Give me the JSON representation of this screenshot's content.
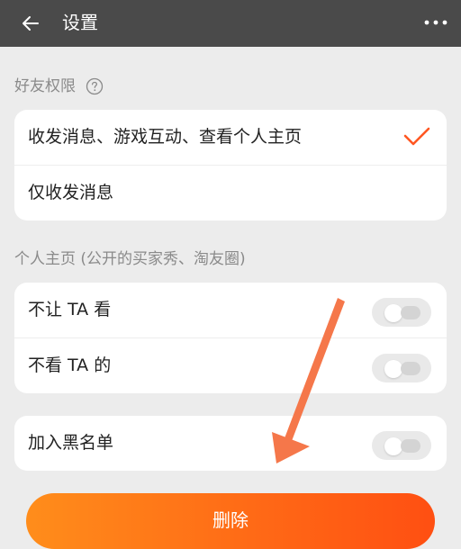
{
  "header": {
    "title": "设置",
    "back_icon": "arrow-left-icon",
    "more_icon": "more-dots-icon"
  },
  "friend_permissions": {
    "label": "好友权限",
    "help_icon": "help-circle-icon",
    "options": [
      {
        "label": "收发消息、游戏互动、查看个人主页",
        "selected": true
      },
      {
        "label": "仅收发消息",
        "selected": false
      }
    ]
  },
  "profile": {
    "label": "个人主页 (公开的买家秀、淘友圈)",
    "items": [
      {
        "label": "不让 TA 看",
        "enabled": false
      },
      {
        "label": "不看 TA 的",
        "enabled": false
      }
    ]
  },
  "blacklist": {
    "label": "加入黑名单",
    "enabled": false
  },
  "delete_button": {
    "label": "删除"
  },
  "colors": {
    "header_bg": "#4a4a4a",
    "accent": "#ff6a16",
    "check": "#ff5722",
    "annotation_arrow": "#f5774a"
  }
}
